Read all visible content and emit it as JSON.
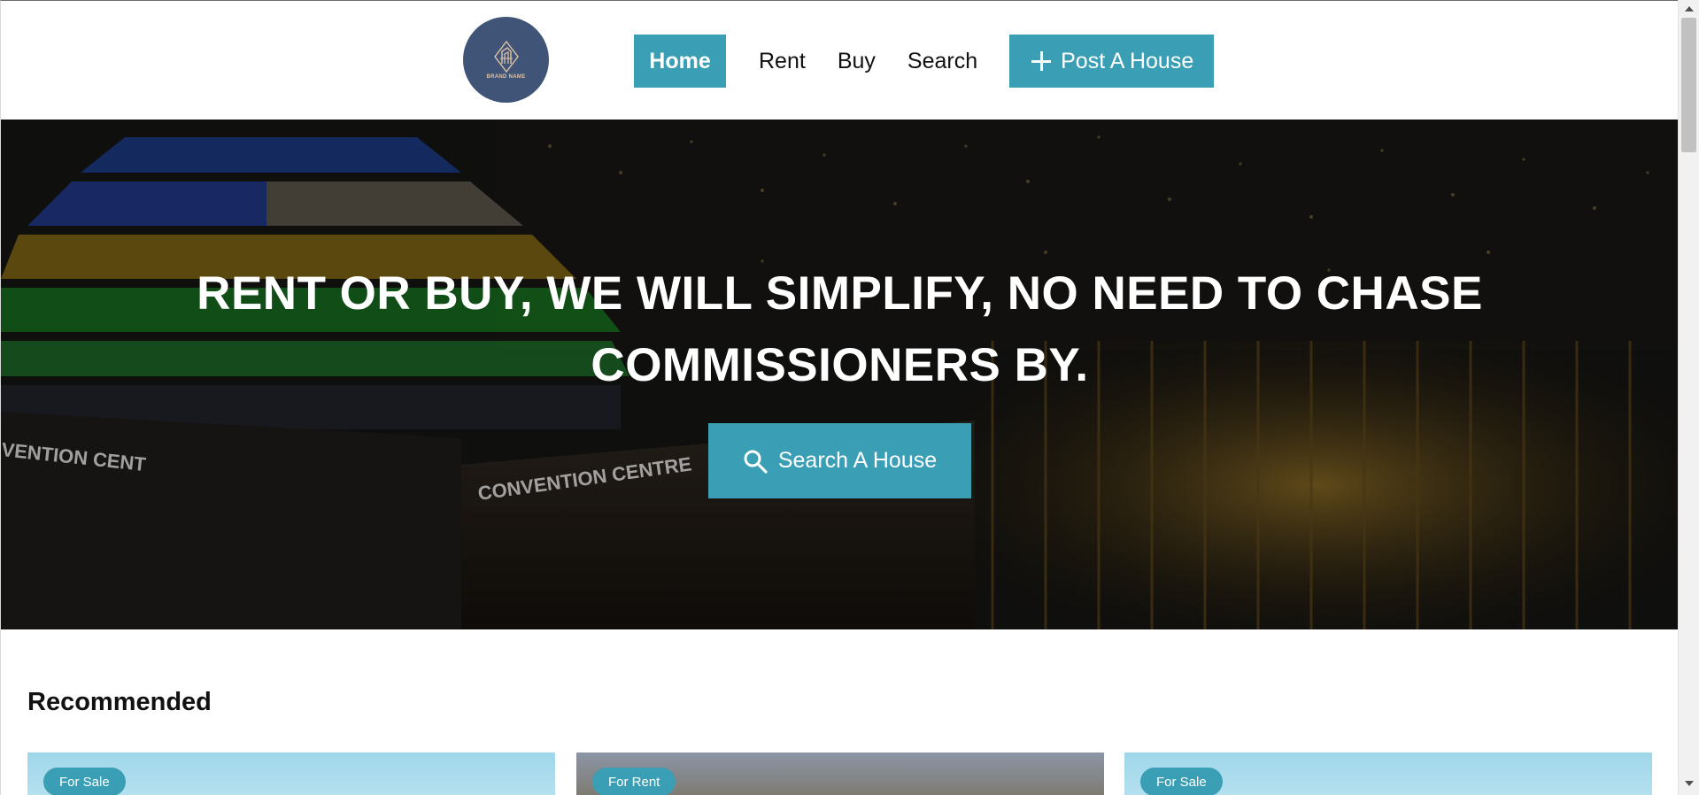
{
  "header": {
    "logo_text": "BRAND NAME",
    "nav": {
      "home": "Home",
      "rent": "Rent",
      "buy": "Buy",
      "search": "Search",
      "post": "Post A House"
    }
  },
  "hero": {
    "title_line1": "RENT OR BUY, WE WILL SIMPLIFY, NO NEED TO CHASE",
    "title_line2": "COMMISSIONERS BY.",
    "search_button": "Search A House",
    "sign_left": "VENTION CENT",
    "sign_center": "CONVENTION CENTRE"
  },
  "recommended": {
    "title": "Recommended",
    "cards": [
      {
        "badge": "For Sale"
      },
      {
        "badge": "For Rent"
      },
      {
        "badge": "For Sale"
      }
    ]
  },
  "colors": {
    "accent": "#3a9fb5",
    "logo_bg": "#3f5476"
  }
}
